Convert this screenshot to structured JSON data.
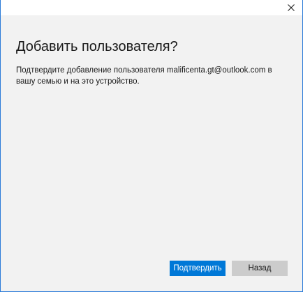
{
  "window": {
    "close_icon": "close-icon"
  },
  "dialog": {
    "title": "Добавить пользователя?",
    "message": "Подтвердите добавление пользователя malificenta.gt@outlook.com в вашу семью и на это устройство.",
    "confirm_label": "Подтвердить",
    "back_label": "Назад"
  },
  "colors": {
    "accent": "#0078d7",
    "border": "#2a7ad8",
    "background": "#f2f2f2",
    "secondary_button": "#cccccc"
  }
}
